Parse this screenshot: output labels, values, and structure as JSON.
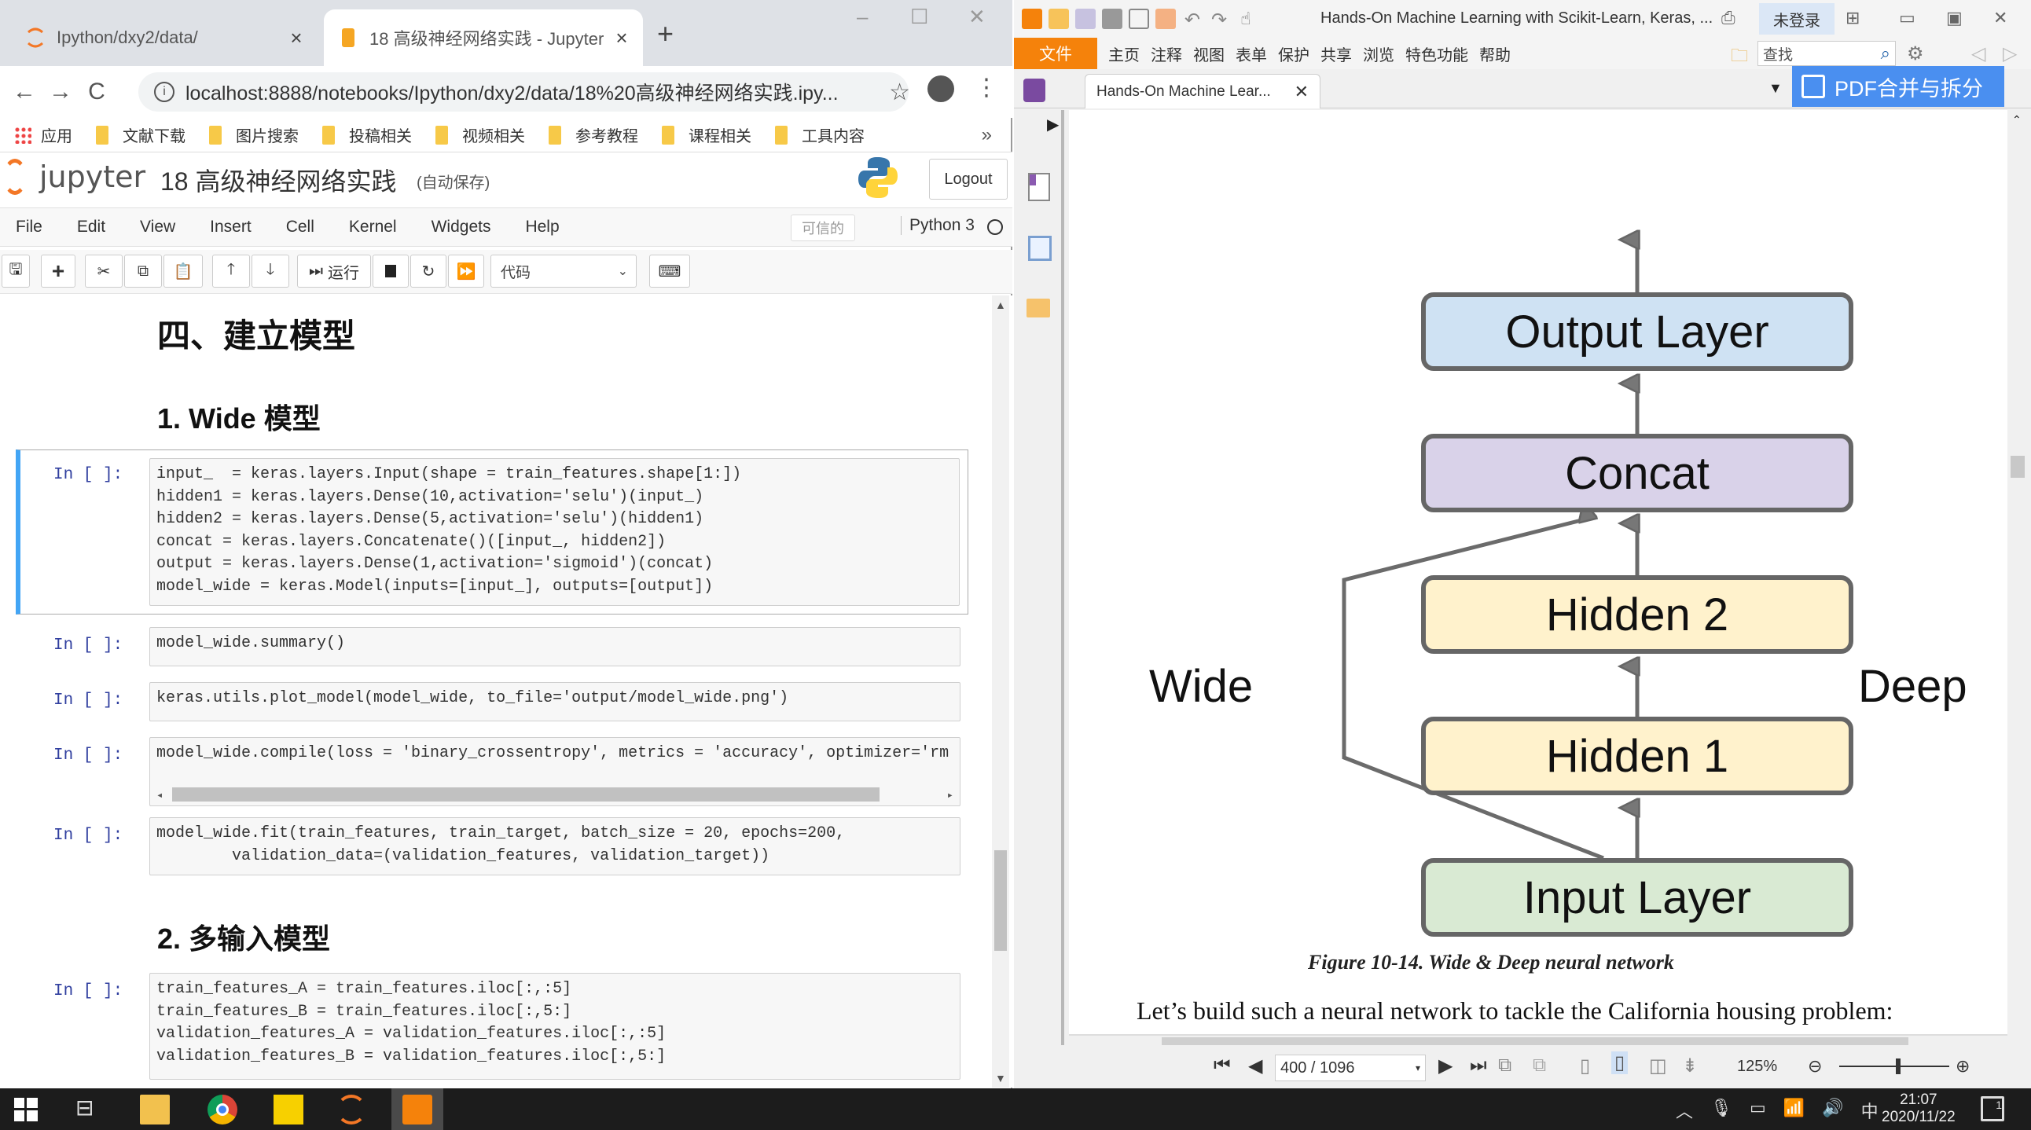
{
  "browser": {
    "tabs": [
      {
        "title": "Ipython/dxy2/data/",
        "active": false
      },
      {
        "title": "18 高级神经网络实践 - Jupyter",
        "active": true
      }
    ],
    "url": "localhost:8888/notebooks/Ipython/dxy2/data/18%20高级神经网络实践.ipy...",
    "bookmarks": [
      "应用",
      "文献下载",
      "图片搜索",
      "投稿相关",
      "视频相关",
      "参考教程",
      "课程相关",
      "工具内容"
    ],
    "bookmarks_more": "»",
    "icons": {
      "back": "←",
      "forward": "→",
      "reload": "C",
      "star": "☆",
      "new_tab": "+",
      "close": "×",
      "kebab": "⋮"
    }
  },
  "jupyter": {
    "logo_text": "jupyter",
    "notebook_name": "18 高级神经网络实践",
    "autosave": "(自动保存)",
    "logout": "Logout",
    "menu": [
      "File",
      "Edit",
      "View",
      "Insert",
      "Cell",
      "Kernel",
      "Widgets",
      "Help"
    ],
    "trusted": "可信的",
    "kernel": "Python 3",
    "toolbar": {
      "run_label": "运行",
      "cell_type": "代码"
    },
    "headings": {
      "section": "四、建立模型",
      "sub1": "1. Wide 模型",
      "sub2": "2. 多输入模型"
    },
    "cells": [
      {
        "prompt": "In [ ]:",
        "lines": [
          "input_  = keras.layers.Input(shape = train_features.shape[1:])",
          "hidden1 = keras.layers.Dense(10,activation='selu')(input_)",
          "hidden2 = keras.layers.Dense(5,activation='selu')(hidden1)",
          "concat = keras.layers.Concatenate()([input_, hidden2])",
          "output = keras.layers.Dense(1,activation='sigmoid')(concat)",
          "model_wide = keras.Model(inputs=[input_], outputs=[output])"
        ]
      },
      {
        "prompt": "In [ ]:",
        "lines": [
          "model_wide.summary()"
        ]
      },
      {
        "prompt": "In [ ]:",
        "lines": [
          "keras.utils.plot_model(model_wide, to_file='output/model_wide.png')"
        ]
      },
      {
        "prompt": "In [ ]:",
        "lines": [
          "model_wide.compile(loss = 'binary_crossentropy', metrics = 'accuracy', optimizer='rm"
        ]
      },
      {
        "prompt": "In [ ]:",
        "lines": [
          "model_wide.fit(train_features, train_target, batch_size = 20, epochs=200,",
          "        validation_data=(validation_features, validation_target))"
        ]
      },
      {
        "prompt": "In [ ]:",
        "lines": [
          "train_features_A = train_features.iloc[:,:5]",
          "train_features_B = train_features.iloc[:,5:]",
          "validation_features_A = validation_features.iloc[:,:5]",
          "validation_features_B = validation_features.iloc[:,5:]"
        ]
      }
    ]
  },
  "pdf": {
    "doc_title": "Hands-On Machine Learning with Scikit-Learn, Keras, ...",
    "login": "未登录",
    "file_btn": "文件",
    "ribbon": [
      "主页",
      "注释",
      "视图",
      "表单",
      "保护",
      "共享",
      "浏览",
      "特色功能",
      "帮助"
    ],
    "search_placeholder": "查找",
    "doc_tab": "Hands-On Machine Lear...",
    "merge_btn": "PDF合并与拆分",
    "diagram": {
      "layers": [
        {
          "label": "Output Layer",
          "color": "#cfe2f3"
        },
        {
          "label": "Concat",
          "color": "#d9d2e9"
        },
        {
          "label": "Hidden 2",
          "color": "#fff2cc"
        },
        {
          "label": "Hidden 1",
          "color": "#fff2cc"
        },
        {
          "label": "Input Layer",
          "color": "#d9ead3"
        }
      ],
      "wide_label": "Wide",
      "deep_label": "Deep"
    },
    "caption": "Figure 10-14. Wide & Deep neural network",
    "body_text": "Let’s build such a neural network to tackle the California housing problem:",
    "page_indicator": "400 / 1096",
    "current_page": 400,
    "total_pages": 1096,
    "zoom": "125%"
  },
  "taskbar": {
    "time": "21:07",
    "date": "2020/11/22",
    "ime": "中",
    "notification_count": "1"
  }
}
